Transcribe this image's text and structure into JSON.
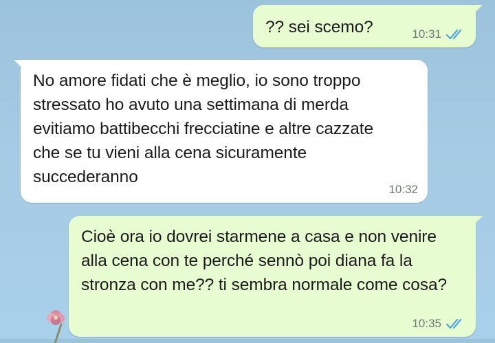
{
  "chat": {
    "messages": [
      {
        "direction": "out",
        "text": "?? sei scemo?",
        "time": "10:31",
        "status_icon": "double-check-read-icon"
      },
      {
        "direction": "in",
        "text": "No amore fidati che è meglio, io sono troppo stressato ho avuto una settimana di merda evitiamo battibecchi frecciatine e altre cazzate che se tu vieni alla cena sicuramente succederanno",
        "time": "10:32"
      },
      {
        "direction": "out",
        "text": "Cioè ora io dovrei starmene a casa e non venire alla cena con te perché sennò poi diana fa la stronza con me?? ti sembra normale come cosa?",
        "time": "10:35",
        "status_icon": "double-check-read-icon"
      }
    ]
  },
  "colors": {
    "outgoing_bubble": "#e7fcd1",
    "incoming_bubble": "#ffffff",
    "read_ticks": "#4fa5e0",
    "wallpaper": "#a6cbe4"
  }
}
